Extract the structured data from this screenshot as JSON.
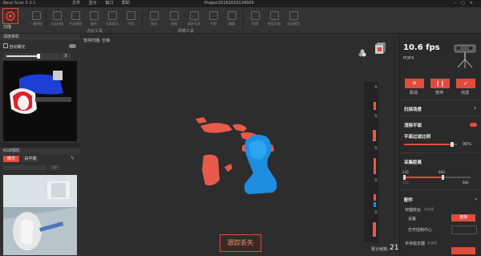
{
  "titlebar": {
    "app": "Revo Scan 5.3.1",
    "menus": [
      "文件",
      "显示",
      "窗口",
      "帮助"
    ],
    "project": "Project20162023134509"
  },
  "toolbar": {
    "scan_label": "扫描",
    "tools": [
      "一键拼接",
      "点云拼接",
      "手动拼接",
      "融合",
      "去离群点",
      "平滑",
      "简化",
      "网格",
      "填补孔洞",
      "平滑",
      "编辑",
      "纹理",
      "模型压缩",
      "导出模型"
    ],
    "groups": [
      "点云工具",
      "网格工具"
    ]
  },
  "left": {
    "depth_title": "深度相机",
    "auto_exposure": "自动曝光",
    "exposure_value": "3",
    "rgb_title": "RGB相机",
    "rgb_modes": [
      "曝光",
      "白平衡"
    ],
    "rgb_value": "50"
  },
  "canvas": {
    "status": "暂停扫描: 空格",
    "tracking_lost": "跟踪丢失",
    "frame_label": "累计帧数:",
    "frame_count": "21"
  },
  "right": {
    "fps": "10.6 fps",
    "device": "POP3",
    "btn_cancel": "取消",
    "btn_pause": "暂停",
    "btn_done": "完成",
    "scan_scene": "扫描场景",
    "remove_plane": "消除平面",
    "plane_filter": "平面过滤比例",
    "plane_pct": "90%",
    "distance": "采集距离",
    "dist_min": "130",
    "dist_max": "600",
    "dist_lo": "120",
    "dist_hi": "680",
    "config": "配件",
    "turntable": "双轴转台",
    "turntable_state": "未连接",
    "device_label": "设备",
    "connect_btn": "连接",
    "open_center": "打开控制中心",
    "handheld": "手持稳定器",
    "handheld_state": "未连接"
  },
  "vtabs": [
    "无",
    "无",
    "无",
    "无",
    "无"
  ],
  "colors": {
    "accent": "#e04c3c",
    "scan_blue": "#1e8fe0",
    "scan_red": "#e85a4a"
  }
}
